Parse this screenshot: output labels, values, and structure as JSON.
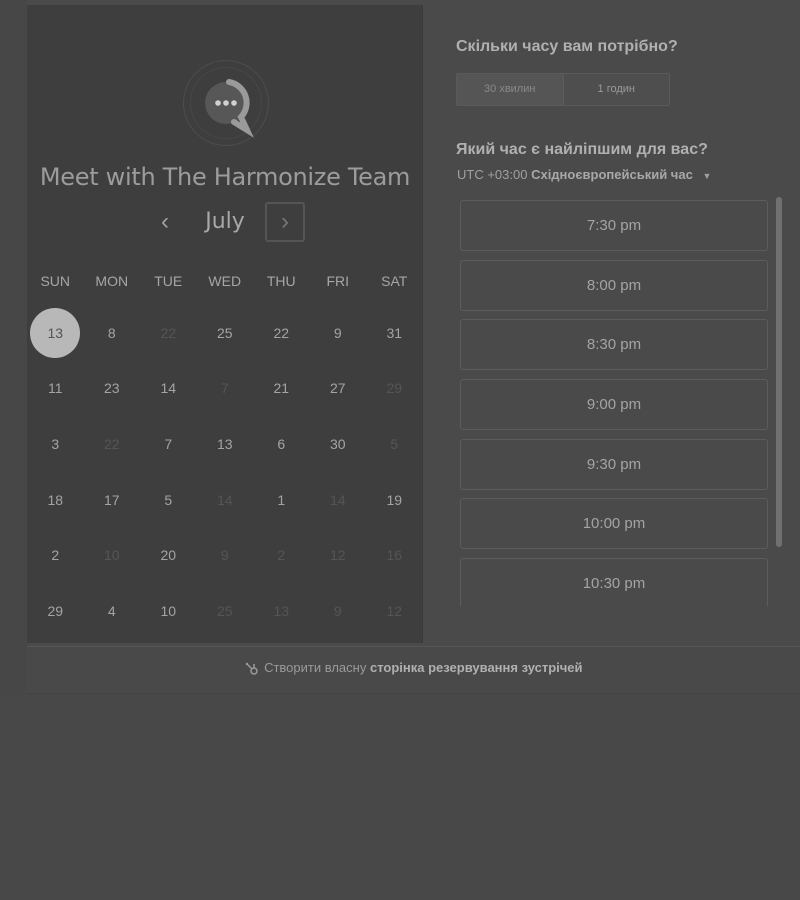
{
  "calendar": {
    "title": "Meet with The Harmonize Team",
    "month": "July",
    "prev_label": "‹",
    "next_label": "›",
    "weekdays": [
      "SUN",
      "MON",
      "TUE",
      "WED",
      "THU",
      "FRI",
      "SAT"
    ],
    "weeks": [
      [
        {
          "d": "13",
          "state": "selected"
        },
        {
          "d": "8",
          "state": "normal"
        },
        {
          "d": "22",
          "state": "dim"
        },
        {
          "d": "25",
          "state": "normal"
        },
        {
          "d": "22",
          "state": "normal"
        },
        {
          "d": "9",
          "state": "normal"
        },
        {
          "d": "31",
          "state": "normal"
        }
      ],
      [
        {
          "d": "11",
          "state": "normal"
        },
        {
          "d": "23",
          "state": "normal"
        },
        {
          "d": "14",
          "state": "normal"
        },
        {
          "d": "7",
          "state": "dim"
        },
        {
          "d": "21",
          "state": "normal"
        },
        {
          "d": "27",
          "state": "normal"
        },
        {
          "d": "29",
          "state": "dim"
        }
      ],
      [
        {
          "d": "3",
          "state": "normal"
        },
        {
          "d": "22",
          "state": "dim"
        },
        {
          "d": "7",
          "state": "normal"
        },
        {
          "d": "13",
          "state": "normal"
        },
        {
          "d": "6",
          "state": "normal"
        },
        {
          "d": "30",
          "state": "normal"
        },
        {
          "d": "5",
          "state": "dim"
        }
      ],
      [
        {
          "d": "18",
          "state": "normal"
        },
        {
          "d": "17",
          "state": "normal"
        },
        {
          "d": "5",
          "state": "normal"
        },
        {
          "d": "14",
          "state": "dim"
        },
        {
          "d": "1",
          "state": "normal"
        },
        {
          "d": "14",
          "state": "dim"
        },
        {
          "d": "19",
          "state": "normal"
        }
      ],
      [
        {
          "d": "2",
          "state": "normal"
        },
        {
          "d": "10",
          "state": "dim"
        },
        {
          "d": "20",
          "state": "normal"
        },
        {
          "d": "9",
          "state": "dim"
        },
        {
          "d": "2",
          "state": "dim"
        },
        {
          "d": "12",
          "state": "dim"
        },
        {
          "d": "16",
          "state": "dim"
        }
      ],
      [
        {
          "d": "29",
          "state": "normal"
        },
        {
          "d": "4",
          "state": "normal"
        },
        {
          "d": "10",
          "state": "normal"
        },
        {
          "d": "25",
          "state": "dim"
        },
        {
          "d": "13",
          "state": "dim"
        },
        {
          "d": "9",
          "state": "dim"
        },
        {
          "d": "12",
          "state": "dim"
        }
      ]
    ]
  },
  "booking": {
    "duration_question": "Скільки часу вам потрібно?",
    "durations": [
      {
        "label": "30 хвилин",
        "active": true
      },
      {
        "label": "1 годин",
        "active": false
      }
    ],
    "time_question": "Який час є найліпшим для вас?",
    "timezone_offset": "UTC +03:00",
    "timezone_name": "Східноєвропейський час",
    "slots": [
      "7:30 pm",
      "8:00 pm",
      "8:30 pm",
      "9:00 pm",
      "9:30 pm",
      "10:00 pm",
      "10:30 pm"
    ]
  },
  "footer": {
    "prefix": "Створити власну",
    "link": "сторінка резервування зустрічей"
  },
  "icons": {
    "avatar": "chat-bubble-icon",
    "footer": "hubspot-sprocket-icon",
    "timezone": "caret-down-icon"
  }
}
